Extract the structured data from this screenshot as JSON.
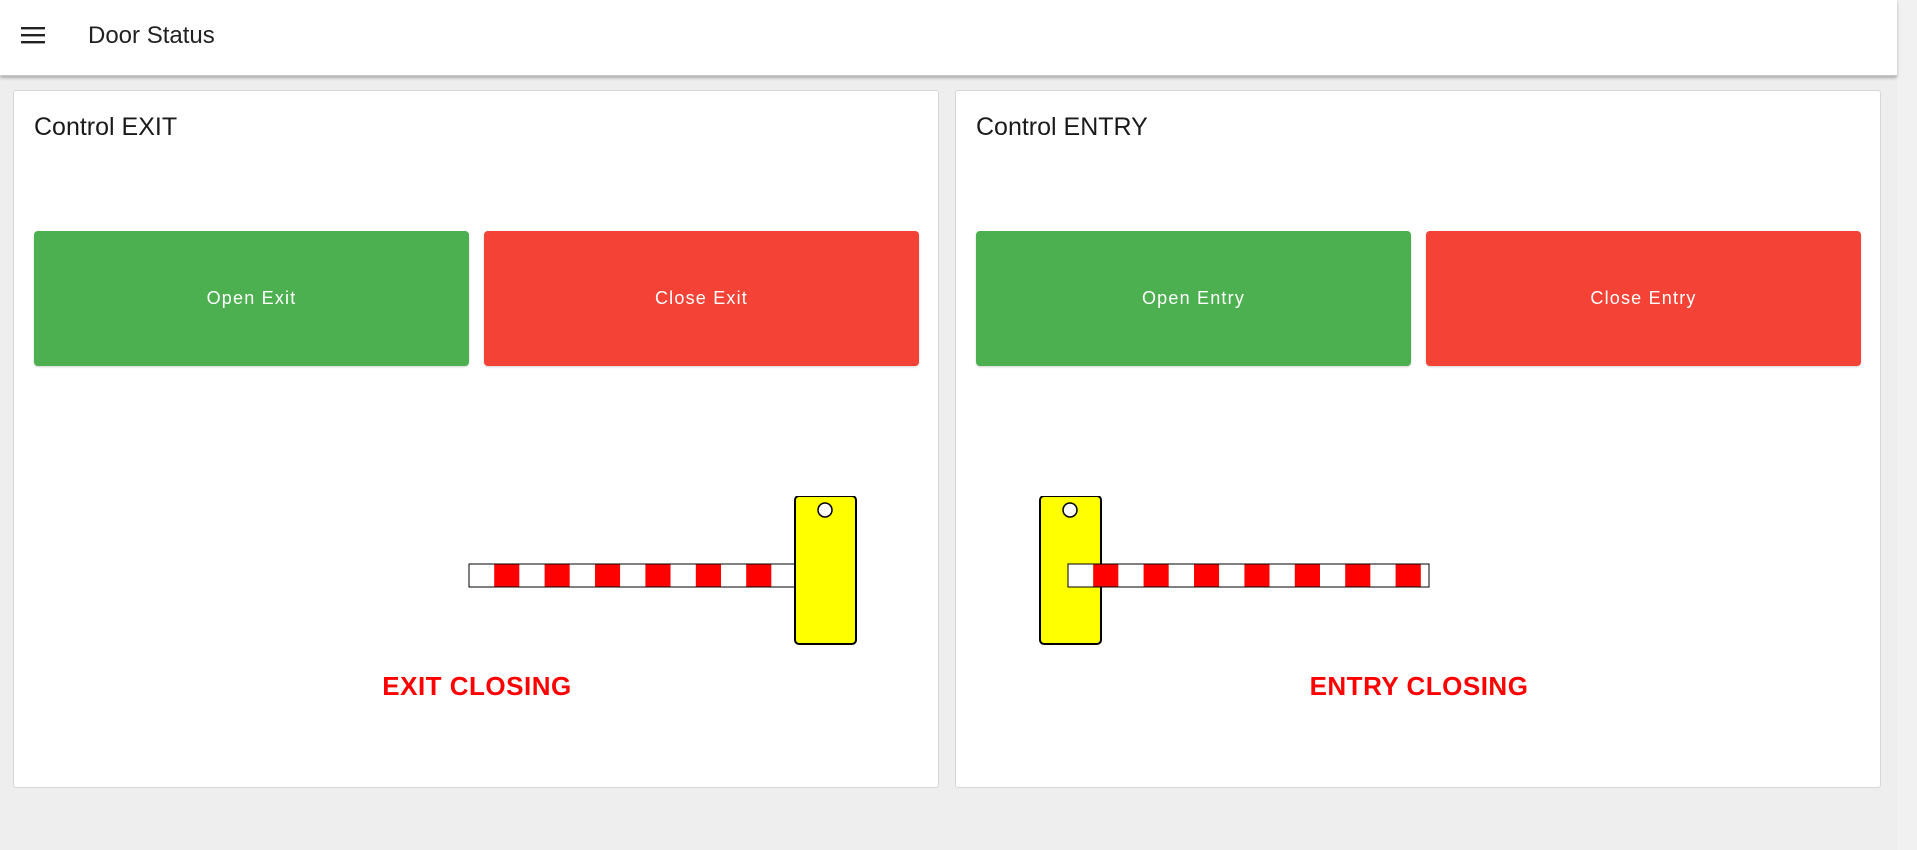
{
  "app_bar": {
    "menu_icon": "hamburger-menu-icon",
    "title": "Door Status"
  },
  "exit_panel": {
    "title": "Control EXIT",
    "open_label": "Open Exit",
    "close_label": "Close Exit",
    "status": "EXIT CLOSING"
  },
  "entry_panel": {
    "title": "Control ENTRY",
    "open_label": "Open Entry",
    "close_label": "Close Entry",
    "status": "ENTRY CLOSING"
  },
  "colors": {
    "open_button": "#4caf50",
    "close_button": "#f44336",
    "status_text": "#ff0000",
    "barrier_post": "#ffff00",
    "barrier_stripe": "#ff0000"
  }
}
